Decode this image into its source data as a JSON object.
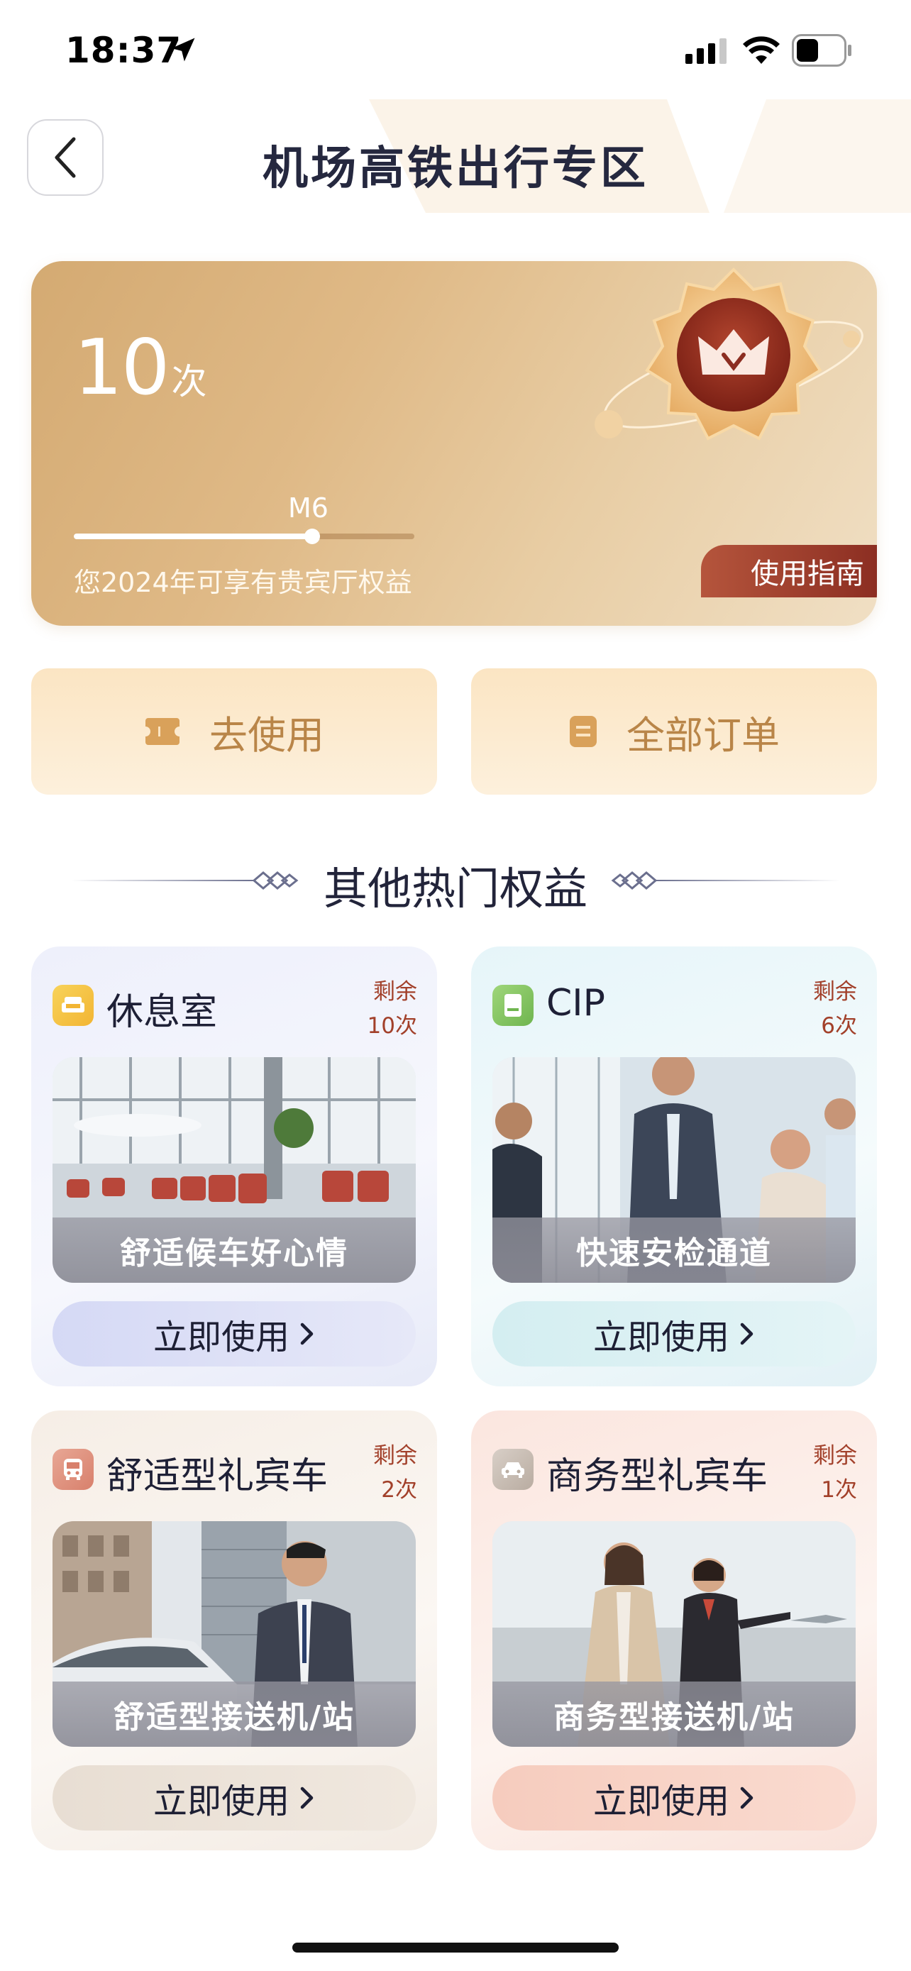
{
  "status_bar": {
    "time": "18:37"
  },
  "header": {
    "title": "机场高铁出行专区"
  },
  "hero": {
    "count": "10",
    "count_unit": "次",
    "level": "M6",
    "progress": 0.7,
    "description": "您2024年可享有贵宾厅权益",
    "guide_label": "使用指南"
  },
  "actions": {
    "use_label": "去使用",
    "orders_label": "全部订单"
  },
  "section": {
    "title": "其他热门权益"
  },
  "cards": [
    {
      "title": "休息室",
      "remain_label": "剩余",
      "remain_count": "10次",
      "caption": "舒适候车好心情",
      "button": "立即使用",
      "icon": "sofa-icon"
    },
    {
      "title": "CIP",
      "remain_label": "剩余",
      "remain_count": "6次",
      "caption": "快速安检通道",
      "button": "立即使用",
      "icon": "pass-icon"
    },
    {
      "title": "舒适型礼宾车",
      "remain_label": "剩余",
      "remain_count": "2次",
      "caption": "舒适型接送机/站",
      "button": "立即使用",
      "icon": "bus-icon"
    },
    {
      "title": "商务型礼宾车",
      "remain_label": "剩余",
      "remain_count": "1次",
      "caption": "商务型接送机/站",
      "button": "立即使用",
      "icon": "car-icon"
    }
  ],
  "colors": {
    "gold": "#d4aa72",
    "accent_red": "#a2402a",
    "action_text": "#b98548"
  }
}
